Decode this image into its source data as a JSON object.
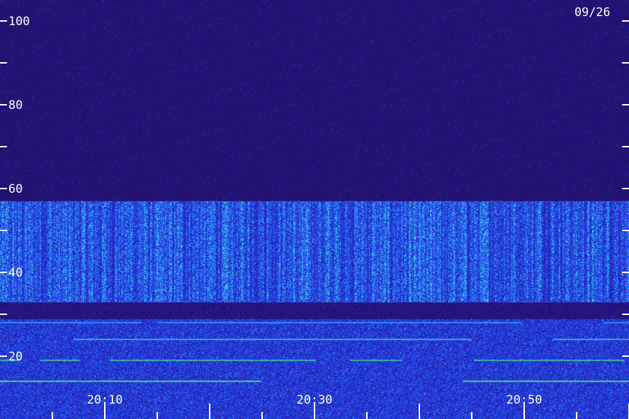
{
  "chart_data": {
    "type": "heatmap",
    "title": "",
    "xlabel": "",
    "ylabel": "",
    "date_label": "09/26",
    "ylim": [
      0,
      100
    ],
    "y_tick_labels": [
      "20",
      "40",
      "60",
      "80",
      "100"
    ],
    "y_minor_ticks": [
      30,
      50,
      70,
      90
    ],
    "xlim": [
      "20:00",
      "21:00"
    ],
    "x_tick_labels": [
      "20:10",
      "20:30",
      "20:50"
    ],
    "x_major_ticks": [
      "20:10",
      "20:20",
      "20:30",
      "20:40",
      "20:50",
      "21:00"
    ],
    "colormap": [
      "#1e0a4a",
      "#2a1a9a",
      "#2030e0",
      "#2b7cff",
      "#40e0ff",
      "#60ff80"
    ],
    "bands": [
      {
        "y_min": 33,
        "y_max": 57,
        "intensity": 0.55,
        "description": "broad blue emission band"
      },
      {
        "y_min": 29,
        "y_max": 33,
        "intensity": 0.15,
        "description": "dark gap"
      },
      {
        "y_min": 0,
        "y_max": 29,
        "intensity": 0.45,
        "description": "low-frequency noise with horizontal lines"
      }
    ],
    "lines": [
      {
        "y": 14,
        "color": "#5dff6a"
      },
      {
        "y": 19,
        "color": "#40e0a0"
      },
      {
        "y": 24,
        "color": "#40c8ff"
      },
      {
        "y": 28,
        "color": "#3aa0ff"
      }
    ]
  }
}
